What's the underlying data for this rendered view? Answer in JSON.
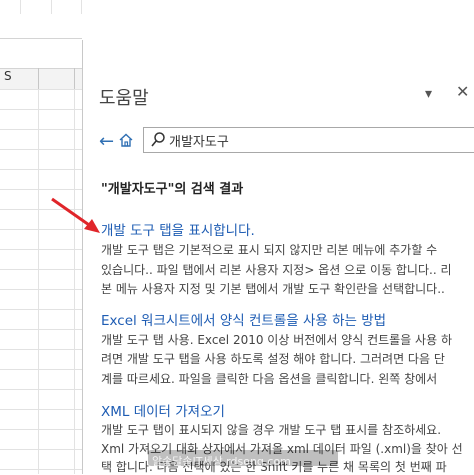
{
  "sheet": {
    "column_label": "S"
  },
  "pane": {
    "title": "도움말",
    "caret": "▾",
    "close": "✕"
  },
  "search": {
    "value": "개발자도구"
  },
  "results_title": "\"개발자도구\"의 검색 결과",
  "results": [
    {
      "link": "개발 도구 탭을 표시합니다.",
      "lines": [
        "개발 도구 탭은 기본적으로 표시 되지 않지만 리본 메뉴에 추가할 수",
        "있습니다.. 파일 탭에서 리본 사용자 지정> 옵션 으로 이동 합니다.. 리",
        "본 메뉴 사용자 지정 및 기본 탭에서 개발 도구 확인란을 선택합니다.."
      ]
    },
    {
      "link": "Excel 워크시트에서 양식 컨트롤을 사용 하는 방법",
      "lines": [
        "개발 도구 탭 사용. Excel 2010 이상 버전에서 양식 컨트롤을 사용 하",
        "려면 개발 도구 탭을 사용 하도록 설정 해야 합니다. 그러려면 다음 단",
        "계를 따르세요. 파일을 클릭한 다음 옵션을 클릭합니다. 왼쪽 창에서"
      ]
    },
    {
      "link": "XML 데이터 가져오기",
      "lines": [
        "개발 도구 탭이 표시되지 않을 경우 개발 도구 탭 표시를 참조하세요.",
        "Xml 가져오기 대화 상자에서 가져올 xml 데이터 파일 (.xml)을 찾아 선",
        "택 합니다. 다음 선택에 있는 한 Shift 키를 누른 채 목록의 첫 번째 파"
      ]
    }
  ],
  "watermark": "알송달송IT세상 rdsong.com",
  "colors": {
    "link": "#1e5cb3",
    "arrow": "#e0252a"
  }
}
